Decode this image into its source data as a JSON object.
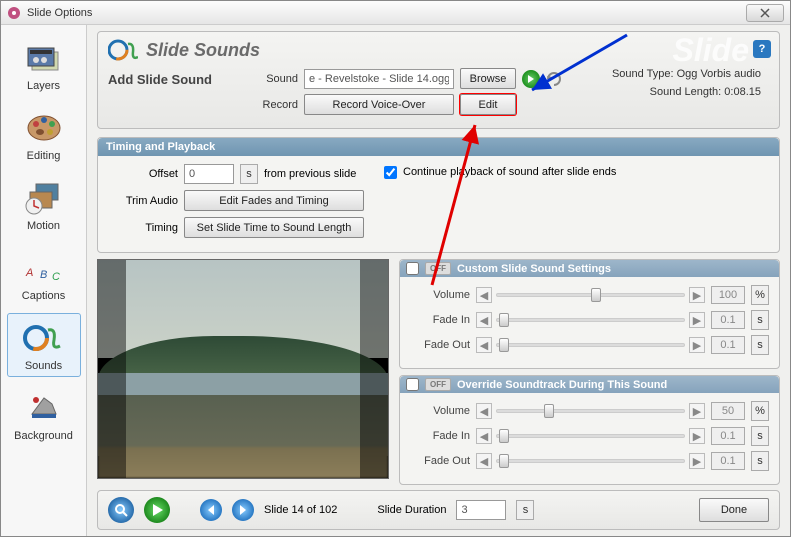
{
  "window": {
    "title": "Slide Options"
  },
  "sidebar": {
    "items": [
      {
        "id": "layers",
        "label": "Layers"
      },
      {
        "id": "editing",
        "label": "Editing"
      },
      {
        "id": "motion",
        "label": "Motion"
      },
      {
        "id": "captions",
        "label": "Captions"
      },
      {
        "id": "sounds",
        "label": "Sounds"
      },
      {
        "id": "background",
        "label": "Background"
      }
    ],
    "selected": "sounds"
  },
  "header": {
    "title": "Slide Sounds",
    "ghost": "Slide",
    "section_label": "Add Slide Sound",
    "sound_label": "Sound",
    "sound_value": "e - Revelstoke - Slide 14.ogg",
    "browse": "Browse",
    "record_label": "Record",
    "record_btn": "Record Voice-Over",
    "edit_btn": "Edit",
    "sound_type_label": "Sound Type:",
    "sound_type_value": "Ogg Vorbis audio",
    "sound_length_label": "Sound Length:",
    "sound_length_value": "0:08.15",
    "help": "?"
  },
  "timing": {
    "head": "Timing and Playback",
    "offset_label": "Offset",
    "offset_value": "0",
    "offset_unit": "s",
    "offset_after": "from previous slide",
    "trim_label": "Trim Audio",
    "trim_btn": "Edit Fades and Timing",
    "timing_label": "Timing",
    "timing_btn": "Set Slide Time to Sound Length",
    "continue_label": "Continue playback of sound after slide ends",
    "continue_checked": true
  },
  "custom": {
    "toggle": "OFF",
    "head": "Custom Slide Sound Settings",
    "volume_label": "Volume",
    "volume_value": "100",
    "volume_unit": "%",
    "fadein_label": "Fade In",
    "fadein_value": "0.1",
    "fadein_unit": "s",
    "fadeout_label": "Fade Out",
    "fadeout_value": "0.1",
    "fadeout_unit": "s"
  },
  "override": {
    "toggle": "OFF",
    "head": "Override Soundtrack During This Sound",
    "volume_label": "Volume",
    "volume_value": "50",
    "volume_unit": "%",
    "fadein_label": "Fade In",
    "fadein_value": "0.1",
    "fadein_unit": "s",
    "fadeout_label": "Fade Out",
    "fadeout_value": "0.1",
    "fadeout_unit": "s"
  },
  "footer": {
    "slide_pos": "Slide 14 of 102",
    "duration_label": "Slide Duration",
    "duration_value": "3",
    "duration_unit": "s",
    "done": "Done"
  }
}
